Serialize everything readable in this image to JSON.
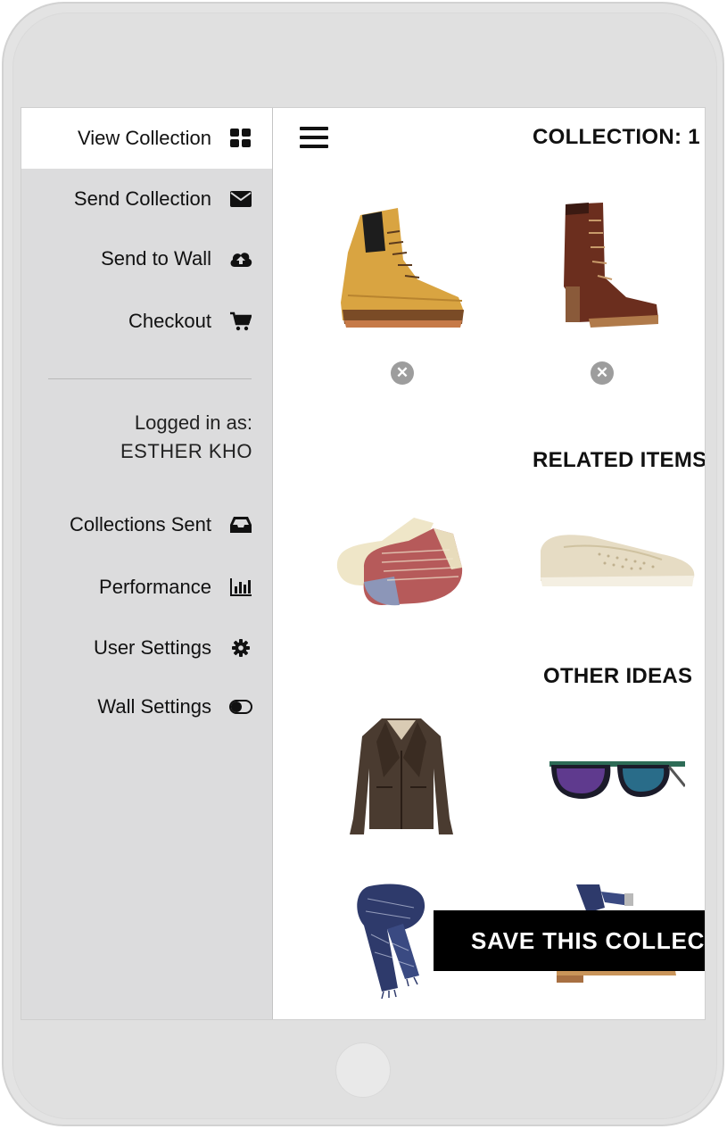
{
  "sidebar": {
    "items": [
      {
        "label": "View Collection",
        "icon": "grid-icon"
      },
      {
        "label": "Send Collection",
        "icon": "envelope-icon"
      },
      {
        "label": "Send to Wall",
        "icon": "cloud-upload-icon"
      },
      {
        "label": "Checkout",
        "icon": "cart-icon"
      }
    ],
    "logged_in_label": "Logged in as:",
    "user_name": "ESTHER KHO",
    "secondary_items": [
      {
        "label": "Collections Sent",
        "icon": "inbox-icon"
      },
      {
        "label": "Performance",
        "icon": "bar-chart-icon"
      },
      {
        "label": "User Settings",
        "icon": "gear-icon"
      },
      {
        "label": "Wall Settings",
        "icon": "toggle-icon"
      }
    ]
  },
  "main": {
    "collection_title": "COLLECTION: 1",
    "related_title": "RELATED ITEMS",
    "other_title": "OTHER IDEAS",
    "save_button": "SAVE THIS COLLECTION"
  },
  "products": {
    "collection": [
      "wheat-work-boot",
      "brown-lace-up-heeled-boot"
    ],
    "related": [
      "striped-ankle-socks",
      "perforated-slip-on-shoe"
    ],
    "other": [
      "leather-biker-jacket",
      "mirrored-sunglasses",
      "blue-knit-scarf",
      "cork-wedge-sandal"
    ]
  },
  "colors": {
    "sidebar_bg": "#dcdcdd",
    "accent": "#000000",
    "remove_icon": "#9d9d9d"
  }
}
